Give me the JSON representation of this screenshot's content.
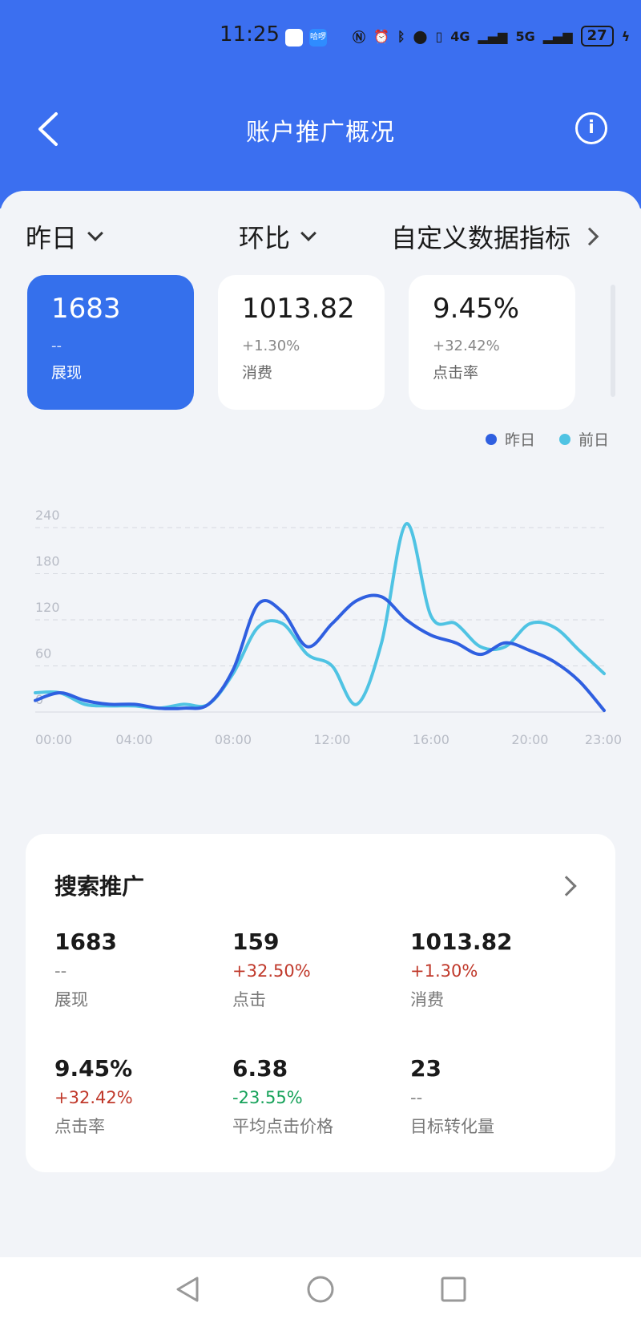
{
  "status": {
    "time": "11:25",
    "app_badge": "哈啰",
    "network": "4G",
    "network2": "5G",
    "battery": "27"
  },
  "nav": {
    "title": "账户推广概况"
  },
  "filters": {
    "date": "昨日",
    "compare": "环比",
    "custom": "自定义数据指标"
  },
  "cards": [
    {
      "value": "1683",
      "change": "--",
      "label": "展现"
    },
    {
      "value": "1013.82",
      "change": "+1.30%",
      "label": "消费"
    },
    {
      "value": "9.45%",
      "change": "+32.42%",
      "label": "点击率"
    }
  ],
  "legend": {
    "yesterday": "昨日",
    "day_before": "前日"
  },
  "colors": {
    "brand": "#3b6ff0",
    "series_yesterday": "#2f5fe0",
    "series_before": "#4fc3e3",
    "up": "#c0392b",
    "down": "#17a25a"
  },
  "chart_data": {
    "type": "line",
    "x_ticks": [
      "00:00",
      "04:00",
      "08:00",
      "12:00",
      "16:00",
      "20:00",
      "23:00"
    ],
    "y_ticks": [
      "240",
      "180",
      "120",
      "60",
      "0"
    ],
    "ylim": [
      0,
      240
    ],
    "x": [
      0,
      1,
      2,
      3,
      4,
      5,
      6,
      7,
      8,
      9,
      10,
      11,
      12,
      13,
      14,
      15,
      16,
      17,
      18,
      19,
      20,
      21,
      22,
      23
    ],
    "series": [
      {
        "name": "昨日",
        "values": [
          15,
          25,
          15,
          10,
          10,
          5,
          5,
          10,
          55,
          140,
          130,
          85,
          115,
          145,
          150,
          120,
          100,
          90,
          75,
          90,
          80,
          65,
          40,
          2
        ]
      },
      {
        "name": "前日",
        "values": [
          25,
          25,
          10,
          8,
          8,
          5,
          10,
          10,
          50,
          110,
          115,
          75,
          60,
          10,
          90,
          245,
          125,
          115,
          85,
          85,
          115,
          110,
          80,
          50
        ]
      }
    ]
  },
  "panel": {
    "title": "搜索推广",
    "metrics": [
      {
        "value": "1683",
        "change": "--",
        "trend": "none",
        "label": "展现"
      },
      {
        "value": "159",
        "change": "+32.50%",
        "trend": "up",
        "label": "点击"
      },
      {
        "value": "1013.82",
        "change": "+1.30%",
        "trend": "up",
        "label": "消费"
      },
      {
        "value": "9.45%",
        "change": "+32.42%",
        "trend": "up",
        "label": "点击率"
      },
      {
        "value": "6.38",
        "change": "-23.55%",
        "trend": "down",
        "label": "平均点击价格"
      },
      {
        "value": "23",
        "change": "--",
        "trend": "none",
        "label": "目标转化量"
      }
    ]
  }
}
